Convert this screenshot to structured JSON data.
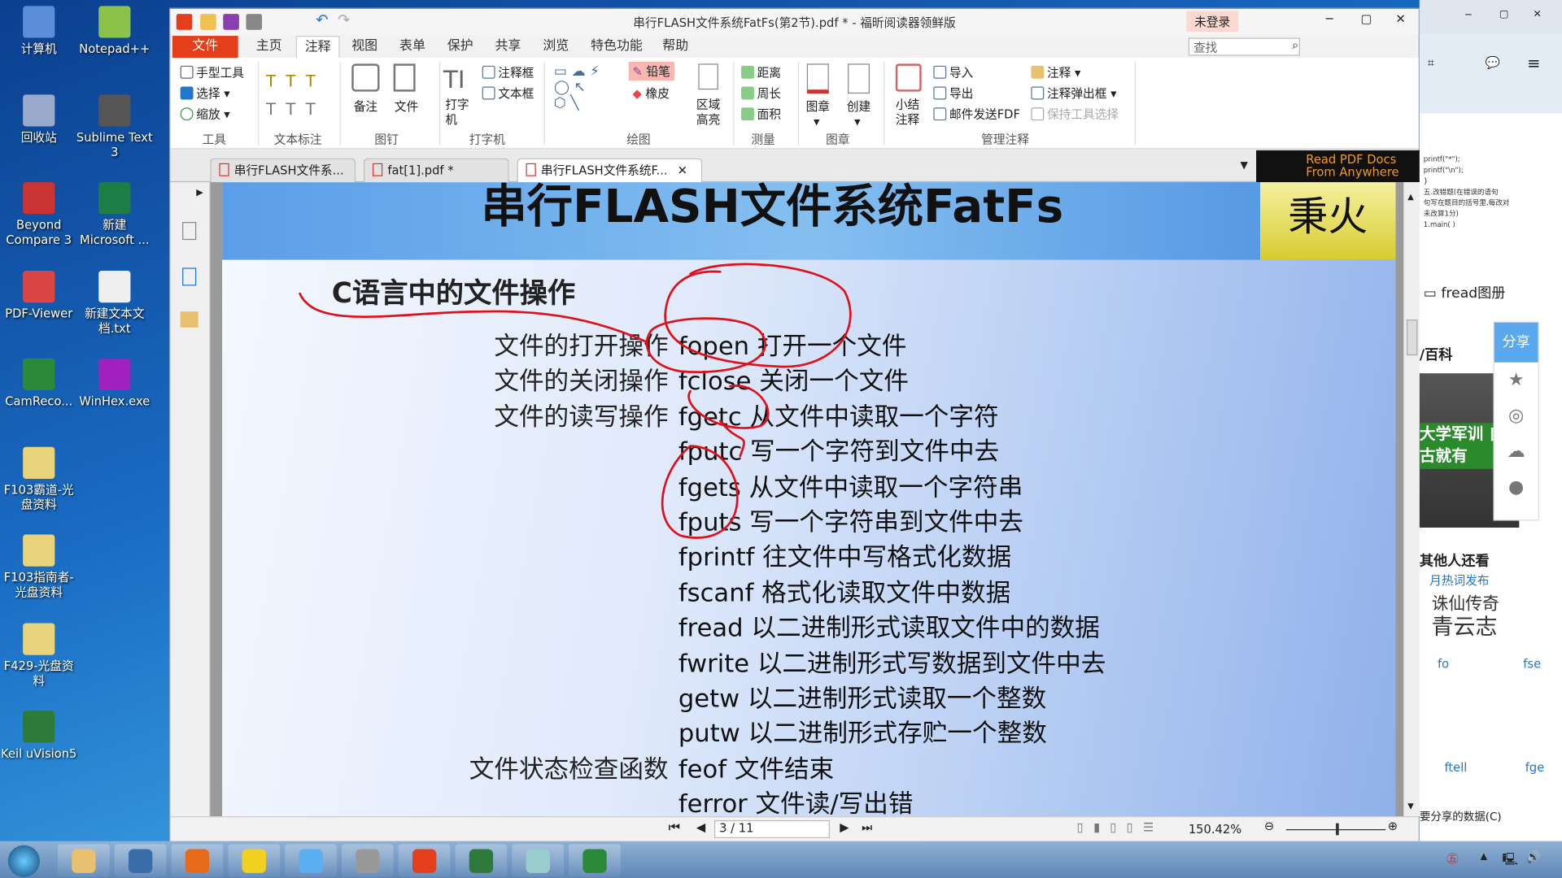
{
  "desktop": {
    "icons": [
      {
        "label": "计算机",
        "color": "#5a8fd8"
      },
      {
        "label": "Notepad++",
        "color": "#8bc34a"
      },
      {
        "label": "回收站",
        "color": "#9ac"
      },
      {
        "label": "Sublime Text 3",
        "color": "#555"
      },
      {
        "label": "Beyond Compare 3",
        "color": "#c33"
      },
      {
        "label": "新建 Microsoft ...",
        "color": "#1e7d45"
      },
      {
        "label": "PDF-Viewer",
        "color": "#d44"
      },
      {
        "label": "新建文本文档.txt",
        "color": "#eee"
      },
      {
        "label": "CamReco...",
        "color": "#2a8a3a"
      },
      {
        "label": "WinHex.exe",
        "color": "#a020c0"
      },
      {
        "label": "F103霸道-光盘资料",
        "color": "#e8d27a"
      },
      {
        "label": "F103指南者-光盘资料",
        "color": "#e8d27a"
      },
      {
        "label": "F429-光盘资料",
        "color": "#e8d27a"
      },
      {
        "label": "Keil uVision5",
        "color": "#2d7a3a"
      }
    ]
  },
  "window": {
    "title": "串行FLASH文件系统FatFs(第2节).pdf * - 福昕阅读器领鲜版",
    "login": "未登录",
    "menu": [
      "文件",
      "主页",
      "注释",
      "视图",
      "表单",
      "保护",
      "共享",
      "浏览",
      "特色功能",
      "帮助"
    ],
    "active_menu": "注释",
    "search_placeholder": "查找"
  },
  "ribbon": {
    "tools": [
      "手型工具",
      "选择",
      "缩放"
    ],
    "groups": [
      "工具",
      "文本标注",
      "图钉",
      "打字机",
      "绘图",
      "测量",
      "图章",
      "管理注释"
    ],
    "pin": [
      "备注",
      "文件"
    ],
    "typewriter": [
      "打字机",
      "注释框",
      "文本框"
    ],
    "draw": [
      "铅笔",
      "橡皮",
      "区域高亮"
    ],
    "measure": [
      "距离",
      "周长",
      "面积"
    ],
    "stamp": [
      "图章",
      "创建"
    ],
    "manage": [
      "小结注释",
      "导入",
      "导出",
      "邮件发送FDF",
      "注释",
      "注释弹出框",
      "保持工具选择"
    ]
  },
  "tabs": [
    {
      "label": "串行FLASH文件系..."
    },
    {
      "label": "fat[1].pdf *"
    },
    {
      "label": "串行FLASH文件系统F..."
    }
  ],
  "ad": "Read PDF Docs From Anywhere",
  "doc": {
    "banner": "串行FLASH文件系统FatFs",
    "logo": "秉火",
    "heading": "C语言中的文件操作",
    "rows": [
      {
        "label": "文件的打开操作",
        "fn": "fopen",
        "desc": "打开一个文件"
      },
      {
        "label": "文件的关闭操作",
        "fn": "fclose",
        "desc": "关闭一个文件"
      },
      {
        "label": "文件的读写操作",
        "fn": "fgetc",
        "desc": "从文件中读取一个字符"
      },
      {
        "label": "",
        "fn": "fputc",
        "desc": "写一个字符到文件中去"
      },
      {
        "label": "",
        "fn": "fgets",
        "desc": "从文件中读取一个字符串"
      },
      {
        "label": "",
        "fn": "fputs",
        "desc": "写一个字符串到文件中去"
      },
      {
        "label": "",
        "fn": "fprintf",
        "desc": "往文件中写格式化数据"
      },
      {
        "label": "",
        "fn": "fscanf",
        "desc": "格式化读取文件中数据"
      },
      {
        "label": "",
        "fn": "fread",
        "desc": "以二进制形式读取文件中的数据"
      },
      {
        "label": "",
        "fn": "fwrite",
        "desc": "以二进制形式写数据到文件中去"
      },
      {
        "label": "",
        "fn": "getw",
        "desc": "以二进制形式读取一个整数"
      },
      {
        "label": "",
        "fn": "putw",
        "desc": "以二进制形式存贮一个整数"
      },
      {
        "label": "文件状态检查函数",
        "fn": "feof",
        "desc": "文件结束"
      },
      {
        "label": "",
        "fn": "ferror",
        "desc": "文件读/写出错"
      }
    ],
    "annotation_color": "#e0101a"
  },
  "status": {
    "page": "3 / 11",
    "zoom": "150.42%",
    "zoom_slider_percent": 50
  },
  "browser": {
    "snippet": [
      "printf(\"*\");",
      "printf(\"\\n\");",
      "}",
      "五.改错题(在错误的语句",
      "句写在题目的括号里,每改对",
      "未改算1分)",
      "1.main(     )"
    ],
    "album": "fread图册",
    "baike": "/百科",
    "banner": "大学军训 自古就有",
    "share": "分享",
    "others": "其他人还看",
    "news": [
      "月热词发布",
      "诛仙传奇",
      "青云志"
    ],
    "thumbs": [
      "fo",
      "fse",
      "ftell",
      "fge"
    ],
    "bottom": "要分享的数据(C)"
  },
  "taskbar": {
    "apps": [
      "explorer",
      "powershell",
      "firefox",
      "app",
      "browser",
      "webcam",
      "foxit",
      "keil",
      "notepad",
      "camtasia"
    ]
  }
}
